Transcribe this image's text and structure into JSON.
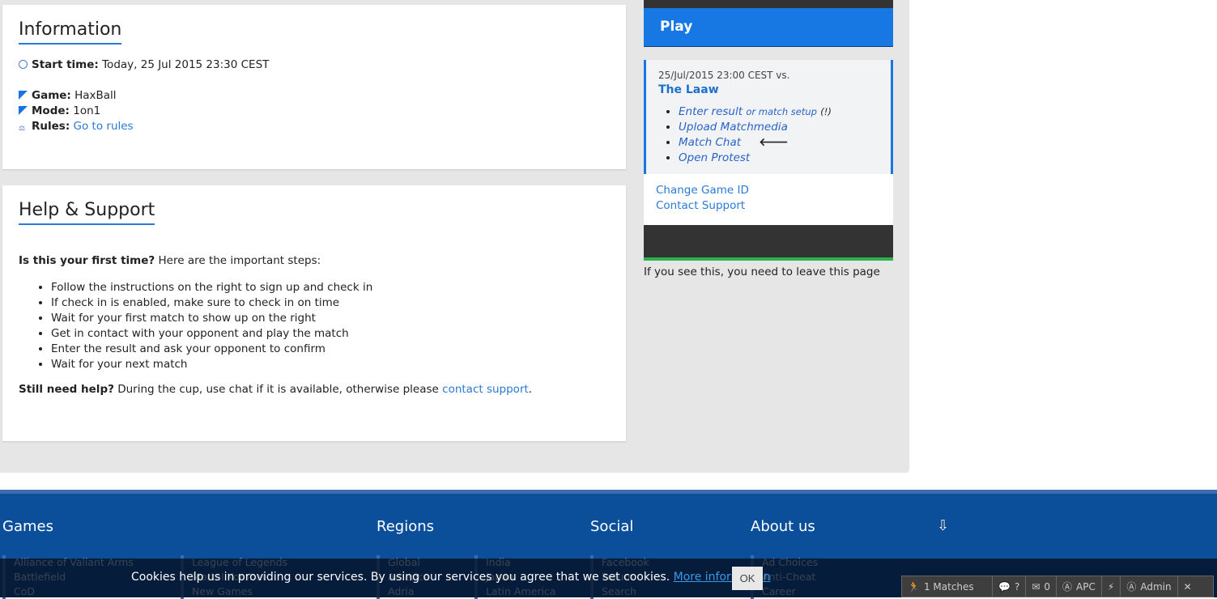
{
  "info": {
    "title": "Information",
    "start_label": "Start time:",
    "start_value": "Today, 25 Jul 2015 23:30 CEST",
    "game_label": "Game:",
    "game_value": "HaxBall",
    "mode_label": "Mode:",
    "mode_value": "1on1",
    "rules_label": "Rules:",
    "rules_link": "Go to rules"
  },
  "help": {
    "title": "Help & Support",
    "intro_bold": "Is this your first time?",
    "intro": " Here are the important steps:",
    "steps": [
      "Follow the instructions on the right to sign up and check in",
      "If check in is enabled, make sure to check in on time",
      "Wait for your first match to show up on the right",
      "Get in contact with your opponent and play the match",
      "Enter the result and ask your opponent to confirm",
      "Wait for your next match"
    ],
    "still_bold": "Still need help?",
    "still": " During the cup, use chat if it is available, otherwise please ",
    "contact": "contact support",
    "period": "."
  },
  "play": {
    "title": "Play",
    "datetime": "25/Jul/2015 23:00 CEST vs.",
    "opponent": "The Laaw",
    "enter_result": "Enter result",
    "match_setup": "or match setup",
    "warn": "(!)",
    "upload": "Upload Matchmedia",
    "chat": "Match Chat",
    "protest": "Open Protest",
    "change_id": "Change Game ID",
    "contact_support": "Contact Support",
    "leave_notice": "If you see this, you need to leave this page"
  },
  "footer": {
    "games": "Games",
    "regions": "Regions",
    "social": "Social",
    "about": "About us",
    "games_col1": [
      "Alliance of Valiant Arms",
      "Battlefield",
      "CoD"
    ],
    "games_col2": [
      "League of Legends",
      "Mortal Kombat",
      "New Games"
    ],
    "regions_col1": [
      "Global",
      "America",
      "Adria"
    ],
    "regions_col2": [
      "India",
      "Japan",
      "Latin America"
    ],
    "social_col": [
      "Facebook",
      "Forum",
      "Search"
    ],
    "about_col": [
      "Ad Choices",
      "Anti-Cheat",
      "Career"
    ]
  },
  "cookie": {
    "text": "Cookies help us in providing our services. By using our services you agree that we set cookies. ",
    "more": "More information",
    "ok": "OK"
  },
  "toolbar": {
    "matches": "1 Matches",
    "chat": "?",
    "mail": "0",
    "apc": "APC",
    "admin": "Admin"
  }
}
